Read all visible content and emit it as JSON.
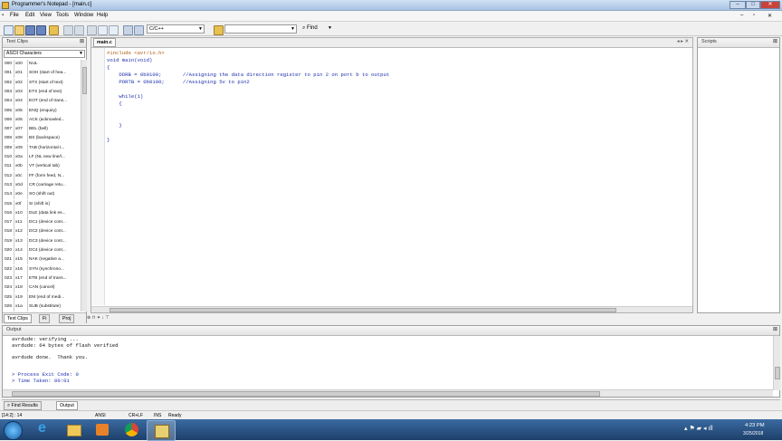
{
  "window": {
    "title": "Programmer's Notepad - [main.c]"
  },
  "menu": [
    "File",
    "Edit",
    "View",
    "Tools",
    "Window",
    "Help"
  ],
  "toolbar": {
    "scheme": "C/C++",
    "find_label": "Find",
    "search_value": ""
  },
  "textclips": {
    "title": "Text Clips",
    "category": "ASCII Characters",
    "rows": [
      [
        "000",
        "x00",
        "NUL"
      ],
      [
        "001",
        "x01",
        "SOH (start of hea..."
      ],
      [
        "002",
        "x02",
        "STX (start of text)"
      ],
      [
        "003",
        "x03",
        "ETX (end of text)"
      ],
      [
        "004",
        "x04",
        "EOT (end of trans..."
      ],
      [
        "005",
        "x05",
        "ENQ (enquiry)"
      ],
      [
        "006",
        "x06",
        "ACK (acknowled..."
      ],
      [
        "007",
        "x07",
        "BEL (bell)"
      ],
      [
        "008",
        "x08",
        "BS (backspace)"
      ],
      [
        "009",
        "x09",
        "TAB (horizontal t..."
      ],
      [
        "010",
        "x0a",
        "LF (NL new line/l..."
      ],
      [
        "011",
        "x0b",
        "VT (vertical tab)"
      ],
      [
        "012",
        "x0c",
        "FF (form feed, N..."
      ],
      [
        "013",
        "x0d",
        "CR (carriage retu..."
      ],
      [
        "014",
        "x0e",
        "SO (shift out)"
      ],
      [
        "015",
        "x0f",
        "SI (shift in)"
      ],
      [
        "016",
        "x10",
        "DLE (data link es..."
      ],
      [
        "017",
        "x11",
        "DC1 (device cont..."
      ],
      [
        "018",
        "x12",
        "DC2 (device cont..."
      ],
      [
        "019",
        "x13",
        "DC3 (device cont..."
      ],
      [
        "020",
        "x14",
        "DC4 (device cont..."
      ],
      [
        "021",
        "x15",
        "NAK (negative a..."
      ],
      [
        "022",
        "x16",
        "SYN (synchrono..."
      ],
      [
        "023",
        "x17",
        "ETB (end of trans..."
      ],
      [
        "024",
        "x18",
        "CAN (cancel)"
      ],
      [
        "025",
        "x19",
        "EM (end of medi..."
      ],
      [
        "026",
        "x1a",
        "SUB (substitute)"
      ]
    ],
    "bottom_tabs": [
      "Text Clips",
      "Fi",
      "Proj"
    ]
  },
  "editor": {
    "tab": "main.c",
    "lines": [
      {
        "code": "#include <avr/io.h>",
        "cls": "pp"
      },
      {
        "code": "void main(void)",
        "cls": "kw"
      },
      {
        "code": "{",
        "cls": "kw"
      },
      {
        "code": "    DDRB = 0b0100;       //Assigning the data direction register to pin 2 on port b to output",
        "cls": "cm"
      },
      {
        "code": "    PORTB = 0b0100;      //Assigning 5v to pin2",
        "cls": "cm"
      },
      {
        "code": "",
        "cls": "kw"
      },
      {
        "code": "    while(1)",
        "cls": "kw"
      },
      {
        "code": "    {",
        "cls": "kw"
      },
      {
        "code": "",
        "cls": "kw"
      },
      {
        "code": "",
        "cls": "kw"
      },
      {
        "code": "    }",
        "cls": "kw"
      },
      {
        "code": "",
        "cls": "kw"
      },
      {
        "code": "}",
        "cls": "kw"
      }
    ]
  },
  "scripts": {
    "title": "Scripts"
  },
  "output": {
    "title": "Output",
    "lines": [
      "avrdude: verifying ...",
      "avrdude: 64 bytes of flash verified",
      "",
      "avrdude done.  Thank you.",
      "",
      "",
      "> Process Exit Code: 0",
      "> Time Taken: 00:01"
    ],
    "tabs": [
      "Find Results",
      "Output"
    ]
  },
  "status": {
    "pos": "[14:2] : 14",
    "encoding": "ANSI",
    "eol": "CR+LF",
    "mode": "INS",
    "state": "Ready"
  },
  "tray": {
    "time": "4:23 PM",
    "date": "3/25/2018"
  }
}
